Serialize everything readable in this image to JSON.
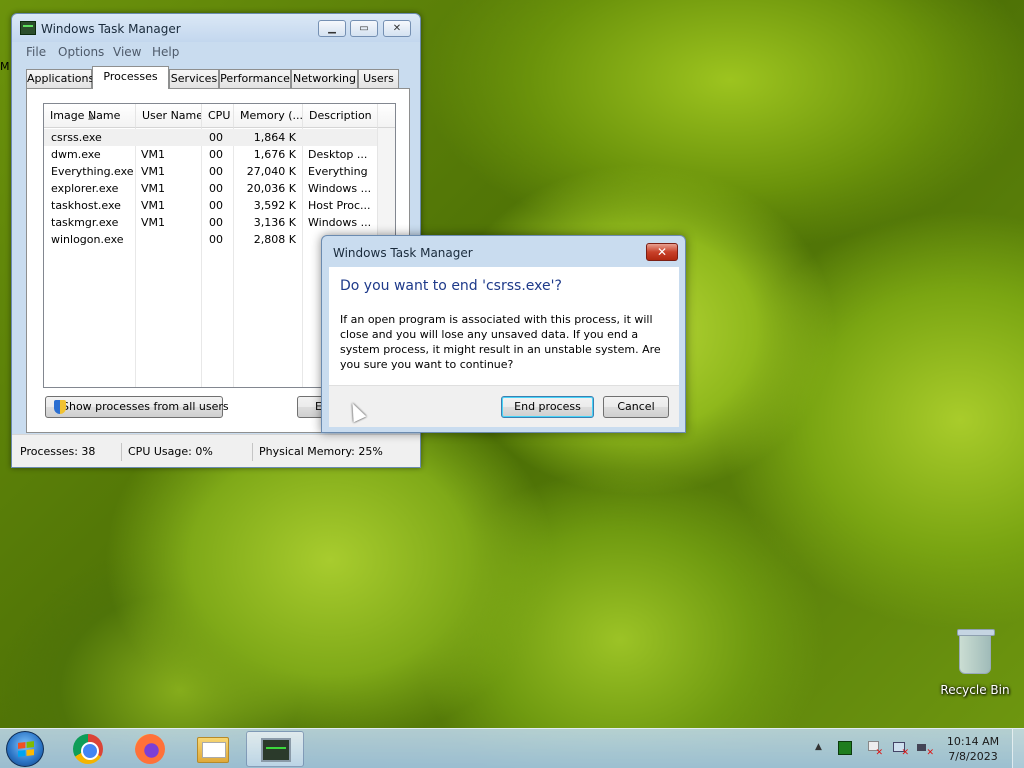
{
  "taskmgr": {
    "title": "Windows Task Manager",
    "menu": [
      "File",
      "Options",
      "View",
      "Help"
    ],
    "tabs": [
      "Applications",
      "Processes",
      "Services",
      "Performance",
      "Networking",
      "Users"
    ],
    "active_tab": "Processes",
    "columns": [
      "Image Name",
      "User Name",
      "CPU",
      "Memory (...",
      "Description"
    ],
    "processes": [
      {
        "image": "csrss.exe",
        "user": "",
        "cpu": "00",
        "memory": "1,864 K",
        "description": ""
      },
      {
        "image": "dwm.exe",
        "user": "VM1",
        "cpu": "00",
        "memory": "1,676 K",
        "description": "Desktop ..."
      },
      {
        "image": "Everything.exe",
        "user": "VM1",
        "cpu": "00",
        "memory": "27,040 K",
        "description": "Everything"
      },
      {
        "image": "explorer.exe",
        "user": "VM1",
        "cpu": "00",
        "memory": "20,036 K",
        "description": "Windows ..."
      },
      {
        "image": "taskhost.exe",
        "user": "VM1",
        "cpu": "00",
        "memory": "3,592 K",
        "description": "Host Proc..."
      },
      {
        "image": "taskmgr.exe",
        "user": "VM1",
        "cpu": "00",
        "memory": "3,136 K",
        "description": "Windows ..."
      },
      {
        "image": "winlogon.exe",
        "user": "",
        "cpu": "00",
        "memory": "2,808 K",
        "description": ""
      }
    ],
    "show_all_button": "Show processes from all users",
    "end_button_partial": "E",
    "status": {
      "processes": "Processes: 38",
      "cpu": "CPU Usage: 0%",
      "memory": "Physical Memory: 25%"
    }
  },
  "dialog": {
    "title": "Windows Task Manager",
    "heading": "Do you want to end 'csrss.exe'?",
    "body": "If an open program is associated with this process, it will close and you will lose any unsaved data. If you end a system process, it might result in an unstable system. Are you sure you want to continue?",
    "confirm": "End process",
    "cancel": "Cancel"
  },
  "desktop": {
    "recycle_bin": "Recycle Bin",
    "left_edge_text": "M"
  },
  "taskbar": {
    "apps": [
      "chrome-icon",
      "firefox-icon",
      "file-explorer-icon",
      "task-manager-icon"
    ],
    "time": "10:14 AM",
    "date": "7/8/2023"
  }
}
